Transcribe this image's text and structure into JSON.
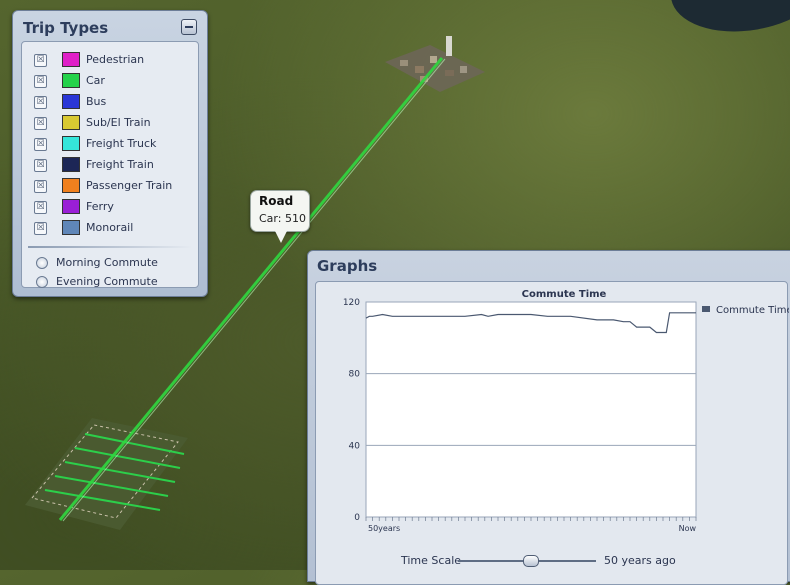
{
  "trip_panel": {
    "title": "Trip Types",
    "items": [
      {
        "label": "Pedestrian",
        "color": "#e020c8"
      },
      {
        "label": "Car",
        "color": "#24d24a"
      },
      {
        "label": "Bus",
        "color": "#2a36d6"
      },
      {
        "label": "Sub/El Train",
        "color": "#d9c932"
      },
      {
        "label": "Freight Truck",
        "color": "#35e6da"
      },
      {
        "label": "Freight Train",
        "color": "#1c2656"
      },
      {
        "label": "Passenger Train",
        "color": "#f0801e"
      },
      {
        "label": "Ferry",
        "color": "#9a1fd6"
      },
      {
        "label": "Monorail",
        "color": "#5f86b8"
      }
    ],
    "commute_options": [
      {
        "label": "Morning Commute"
      },
      {
        "label": "Evening Commute"
      }
    ]
  },
  "tooltip": {
    "title": "Road",
    "text": "Car: 510"
  },
  "graphs_panel": {
    "title": "Graphs",
    "time_scale_label": "Time Scale",
    "time_scale_value": "50 years ago",
    "time_scale_position": 0.52
  },
  "chart_data": {
    "type": "line",
    "title": "Commute Time",
    "xlabel": "",
    "ylabel": "",
    "x_tick_labels": [
      "50years",
      "Now"
    ],
    "y_ticks": [
      0,
      40,
      80,
      120
    ],
    "ylim": [
      0,
      120
    ],
    "grid": true,
    "legend_position": "right",
    "series": [
      {
        "name": "Commute Time",
        "color": "#4a5870",
        "x": [
          0,
          1,
          2,
          5,
          8,
          10,
          13,
          20,
          30,
          35,
          37,
          40,
          45,
          50,
          55,
          60,
          62,
          70,
          75,
          78,
          80,
          82,
          83,
          86,
          88,
          89,
          91,
          92,
          95,
          100
        ],
        "values": [
          111,
          112,
          112,
          113,
          112,
          112,
          112,
          112,
          112,
          113,
          112,
          113,
          113,
          113,
          112,
          112,
          112,
          110,
          110,
          109,
          109,
          106,
          106,
          106,
          103,
          103,
          103,
          114,
          114,
          114
        ]
      }
    ]
  }
}
